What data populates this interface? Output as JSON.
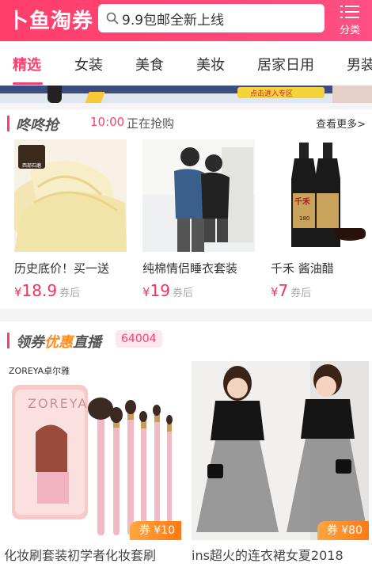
{
  "header": {
    "logo": "卜鱼淘券",
    "search_value": "9.9包邮全新上线",
    "category_label": "分类"
  },
  "tabs": [
    {
      "label": "精选"
    },
    {
      "label": "女装"
    },
    {
      "label": "美食"
    },
    {
      "label": "美妆"
    },
    {
      "label": "居家日用"
    },
    {
      "label": "男装"
    }
  ],
  "banner": {
    "text": "点击进入专区"
  },
  "dongdong": {
    "title": "咚咚抢",
    "time": "10:00",
    "status": "正在抢购",
    "more": "查看更多>",
    "items": [
      {
        "name": "历史底价！买一送",
        "currency": "¥",
        "price": "18.9",
        "after": "券后",
        "brand": "西部石磨"
      },
      {
        "name": "纯棉情侣睡衣套装",
        "currency": "¥",
        "price": "19",
        "after": "券后"
      },
      {
        "name": "千禾 酱油醋",
        "currency": "¥",
        "price": "7",
        "after": "券后",
        "label_a": "千禾",
        "label_b": "180"
      }
    ]
  },
  "live": {
    "title_a": "领券",
    "title_b": "优惠",
    "title_c": "直播",
    "count": "64004",
    "items": [
      {
        "name": "化妆刷套装初学者化妆套刷",
        "coupon": "券 ¥10",
        "brand": "ZOREYA卓尔雅",
        "brand_box": "ZOREYA"
      },
      {
        "name": "ins超火的连衣裙女夏2018",
        "coupon": "券 ¥80"
      }
    ]
  },
  "colors": {
    "accent": "#ff3d6e",
    "price": "#ff2f5a",
    "coupon": "#ff8a1d"
  }
}
